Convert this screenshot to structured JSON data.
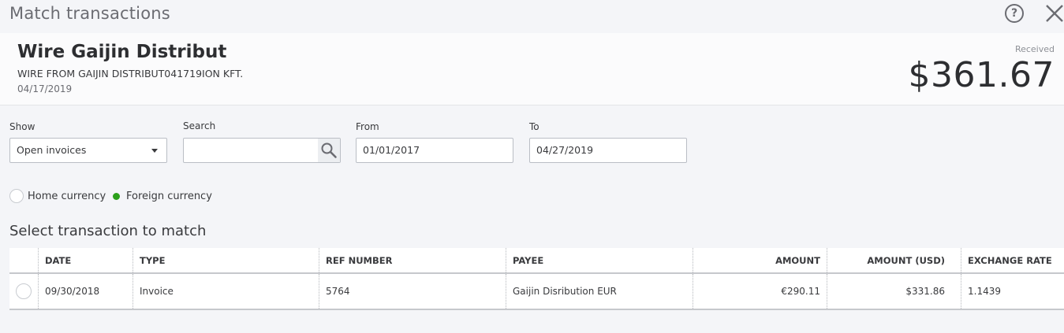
{
  "dialog": {
    "title": "Match transactions"
  },
  "bank_transaction": {
    "description": "Wire Gaijin Distribut",
    "memo": "WIRE FROM GAIJIN DISTRIBUT041719ION KFT.",
    "date": "04/17/2019",
    "direction_label": "Received",
    "amount": "$361.67"
  },
  "filters": {
    "show_label": "Show",
    "show_value": "Open invoices",
    "search_label": "Search",
    "search_value": "",
    "from_label": "From",
    "from_value": "01/01/2017",
    "to_label": "To",
    "to_value": "04/27/2019"
  },
  "currency": {
    "home_label": "Home currency",
    "foreign_label": "Foreign currency",
    "selected": "foreign",
    "accent_color": "#2ca01c"
  },
  "section_title": "Select transaction to match",
  "table": {
    "columns": [
      "DATE",
      "TYPE",
      "REF NUMBER",
      "PAYEE",
      "AMOUNT",
      "AMOUNT (USD)",
      "EXCHANGE RATE"
    ],
    "rows": [
      {
        "date": "09/30/2018",
        "type": "Invoice",
        "ref": "5764",
        "payee": "Gaijin Disribution EUR",
        "amount": "€290.11",
        "amount_usd": "$331.86",
        "rate": "1.1439",
        "selected": false
      }
    ]
  },
  "icons": {
    "help": "help-circle-icon",
    "close": "close-icon",
    "search": "search-icon",
    "dropdown": "caret-down-icon"
  }
}
